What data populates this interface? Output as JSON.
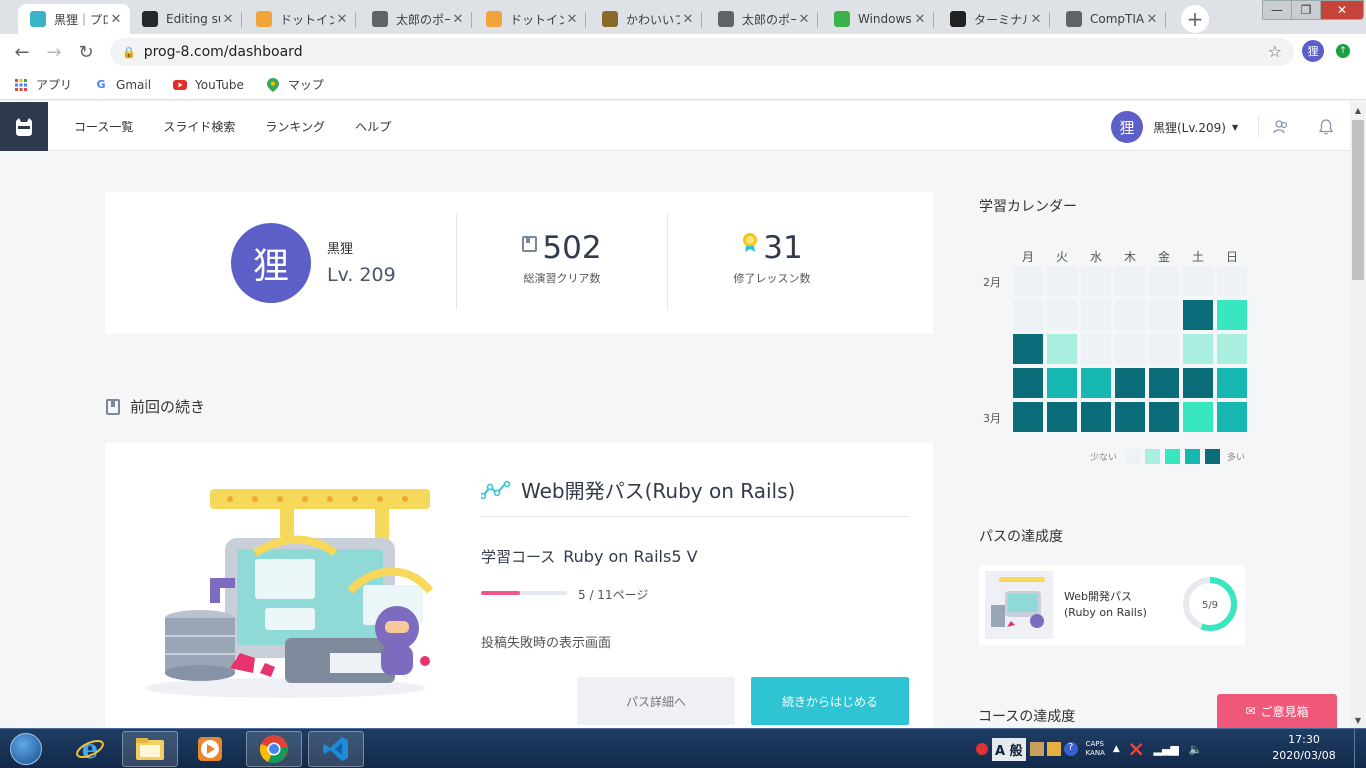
{
  "browser": {
    "tabs": [
      {
        "title": "黒狸｜プロ",
        "favicon": "hacker-site-icon",
        "color": "#3ab3c8",
        "active": true
      },
      {
        "title": "Editing su",
        "favicon": "github-icon",
        "color": "#24292e"
      },
      {
        "title": "ドットインス",
        "favicon": "box-icon",
        "color": "#f2a33a"
      },
      {
        "title": "太郎のポー",
        "favicon": "globe-icon",
        "color": "#5f6368"
      },
      {
        "title": "ドットインス",
        "favicon": "box-icon",
        "color": "#f2a33a"
      },
      {
        "title": "かわいいフ",
        "favicon": "bracket-icon",
        "color": "#8a6a2a"
      },
      {
        "title": "太郎のポー",
        "favicon": "globe-icon",
        "color": "#5f6368"
      },
      {
        "title": "Windows",
        "favicon": "q-icon",
        "color": "#3cb34a"
      },
      {
        "title": "ターミナル",
        "favicon": "wikipedia-icon",
        "color": "#222"
      },
      {
        "title": "CompTIA",
        "favicon": "globe-icon",
        "color": "#5f6368"
      }
    ],
    "tab_close": "✕",
    "new_tab": "+",
    "window": {
      "minimize": "—",
      "maximize": "❐",
      "close": "✕"
    },
    "url": "prog-8.com/dashboard",
    "profile_initial": "狸",
    "bookmarks": [
      {
        "label": "アプリ",
        "icon": "apps-grid-icon"
      },
      {
        "label": "Gmail",
        "icon": "google-icon"
      },
      {
        "label": "YouTube",
        "icon": "youtube-icon"
      },
      {
        "label": "マップ",
        "icon": "maps-pin-icon"
      }
    ]
  },
  "site": {
    "nav": [
      "コース一覧",
      "スライド検索",
      "ランキング",
      "ヘルプ"
    ],
    "user": {
      "initial": "狸",
      "label": "黒狸(Lv.209)"
    },
    "profile": {
      "initial": "狸",
      "name": "黒狸",
      "level": "Lv. 209",
      "stats": [
        {
          "value": "502",
          "label": "総演習クリア数",
          "icon": "book-icon"
        },
        {
          "value": "31",
          "label": "修了レッスン数",
          "icon": "medal-icon"
        }
      ]
    },
    "continue": {
      "section_title": "前回の続き",
      "path_title": "Web開発パス(Ruby on Rails)",
      "course_label": "学習コース",
      "course_name": "Ruby on Rails5 V",
      "progress": 0.45,
      "pages": "5 / 11ページ",
      "lesson": "投稿失敗時の表示画面",
      "detail_button": "パス詳細へ",
      "continue_button": "続きからはじめる"
    },
    "calendar": {
      "title": "学習カレンダー",
      "days": [
        "月",
        "火",
        "水",
        "木",
        "金",
        "土",
        "日"
      ],
      "month_labels": [
        {
          "label": "2月",
          "row": 0
        },
        {
          "label": "3月",
          "row": 4
        }
      ],
      "levels": [
        [
          0,
          0,
          0,
          0,
          0,
          0,
          0
        ],
        [
          0,
          0,
          0,
          0,
          0,
          4,
          2
        ],
        [
          4,
          1,
          0,
          0,
          0,
          1,
          1
        ],
        [
          4,
          3,
          3,
          4,
          4,
          4,
          3
        ],
        [
          4,
          4,
          4,
          4,
          4,
          2,
          3
        ]
      ],
      "colors": [
        "#eef1f6",
        "#a9efe0",
        "#38e6c0",
        "#16b7b0",
        "#0b6c7a"
      ],
      "legend_low": "少ない",
      "legend_high": "多い"
    },
    "path_progress": {
      "title": "パスの達成度",
      "name": "Web開発パス(Ruby on Rails)",
      "ratio": "5/9",
      "done": 5,
      "total": 9
    },
    "course_progress_title": "コースの達成度",
    "feedback_button": "ご意見箱"
  },
  "taskbar": {
    "apps": [
      "ie-icon",
      "explorer-icon",
      "media-player-icon",
      "chrome-icon",
      "vscode-icon"
    ],
    "tray": {
      "ime": "A 般",
      "caps": "CAPS",
      "kana": "KANA"
    },
    "time": "17:30",
    "date": "2020/03/08"
  }
}
